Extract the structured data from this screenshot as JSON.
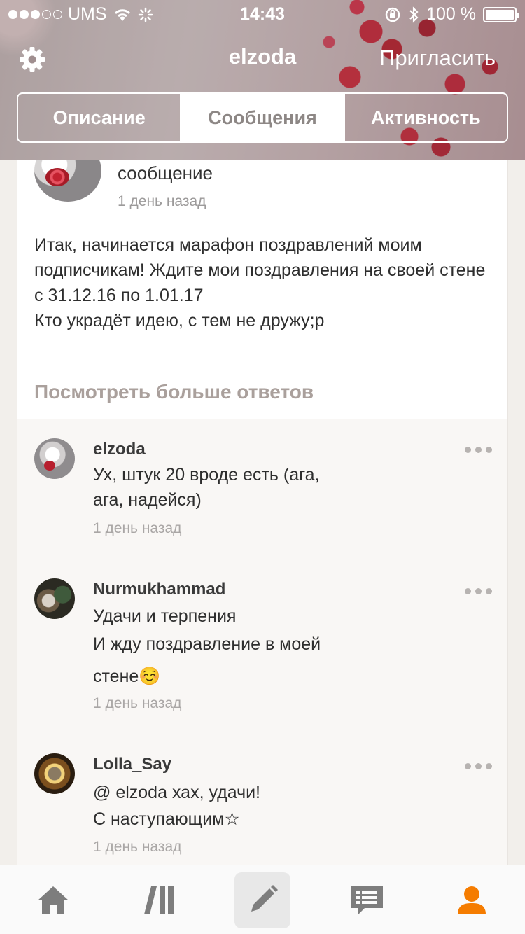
{
  "status_bar": {
    "carrier": "UMS",
    "time": "14:43",
    "battery": "100 %"
  },
  "nav": {
    "title": "elzoda",
    "invite_label": "Пригласить",
    "settings_icon": "gear-icon"
  },
  "tabs": [
    {
      "label": "Описание",
      "active": false
    },
    {
      "label": "Сообщения",
      "active": true
    },
    {
      "label": "Активность",
      "active": false
    }
  ],
  "post": {
    "type_label": "сообщение",
    "time": "1 день назад",
    "body_lines": [
      "Итак, начинается марафон поздравлений моим подписчикам! Ждите мои поздравления на своей стене с 31.12.16 по 1.01.17",
      "Кто украдёт идею, с тем не дружу;р"
    ]
  },
  "more_answers_label": "Посмотреть больше ответов",
  "replies": [
    {
      "author": "elzoda",
      "text_lines": [
        "Ух, штук 20 вроде есть (ага,",
        "ага, надейся)"
      ],
      "time": "1 день назад"
    },
    {
      "author": "Nurmukhammad",
      "text_lines": [
        "Удачи и терпения",
        "И жду поздравление в моей",
        "стене☺️"
      ],
      "time": "1 день назад"
    },
    {
      "author": "Lolla_Say",
      "text_lines": [
        "@ elzoda  хах, удачи!",
        "С наступающим☆"
      ],
      "time": "1 день назад"
    }
  ],
  "tabbar": {
    "items": [
      "home-icon",
      "feed-icon",
      "compose-icon",
      "messages-icon",
      "profile-icon"
    ],
    "active_color": "#f57c00",
    "inactive_color": "#7d7d7d"
  }
}
